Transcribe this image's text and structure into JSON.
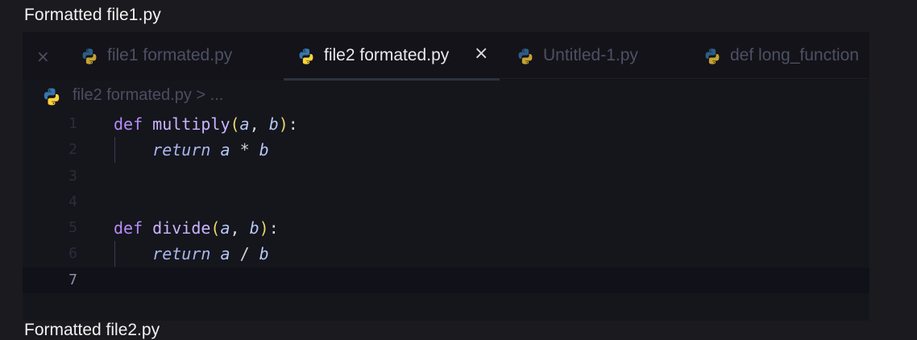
{
  "caption": {
    "top": "Formatted file1.py",
    "bottom": "Formatted file2.py"
  },
  "tabs": [
    {
      "label": "file1 formated.py",
      "active": false
    },
    {
      "label": "file2 formated.py",
      "active": true
    },
    {
      "label": "Untitled-1.py",
      "active": false
    },
    {
      "label": "def long_function",
      "active": false
    }
  ],
  "tab_close_glyph": "×",
  "breadcrumb": {
    "file": "file2 formated.py",
    "separator": ">",
    "rest": "..."
  },
  "code": {
    "lines": [
      {
        "num": "1",
        "tokens": [
          [
            "kw",
            "def"
          ],
          [
            "sp",
            " "
          ],
          [
            "fn",
            "multiply"
          ],
          [
            "p1",
            "("
          ],
          [
            "param",
            "a"
          ],
          [
            "punc",
            ", "
          ],
          [
            "param",
            "b"
          ],
          [
            "p1",
            ")"
          ],
          [
            "punc",
            ":"
          ]
        ]
      },
      {
        "num": "2",
        "tokens": [
          [
            "sp",
            "    "
          ],
          [
            "ret",
            "return"
          ],
          [
            "sp",
            " "
          ],
          [
            "param",
            "a"
          ],
          [
            "sp",
            " "
          ],
          [
            "op",
            "*"
          ],
          [
            "sp",
            " "
          ],
          [
            "param",
            "b"
          ]
        ]
      },
      {
        "num": "3",
        "tokens": []
      },
      {
        "num": "4",
        "tokens": []
      },
      {
        "num": "5",
        "tokens": [
          [
            "kw",
            "def"
          ],
          [
            "sp",
            " "
          ],
          [
            "fn",
            "divide"
          ],
          [
            "p1",
            "("
          ],
          [
            "param",
            "a"
          ],
          [
            "punc",
            ", "
          ],
          [
            "param",
            "b"
          ],
          [
            "p1",
            ")"
          ],
          [
            "punc",
            ":"
          ]
        ]
      },
      {
        "num": "6",
        "tokens": [
          [
            "sp",
            "    "
          ],
          [
            "ret",
            "return"
          ],
          [
            "sp",
            " "
          ],
          [
            "param",
            "a"
          ],
          [
            "sp",
            " "
          ],
          [
            "op",
            "/"
          ],
          [
            "sp",
            " "
          ],
          [
            "param",
            "b"
          ]
        ]
      },
      {
        "num": "7",
        "tokens": [],
        "current": true
      }
    ]
  },
  "colors": {
    "editor_bg": "#15151c",
    "tabbar_bg": "#131319",
    "keyword": "#b58cf6",
    "function": "#c9b5ff",
    "paren": "#e8d76a",
    "param": "#b7c7f5",
    "python_blue": "#3776ab",
    "python_yellow": "#ffd43b"
  }
}
